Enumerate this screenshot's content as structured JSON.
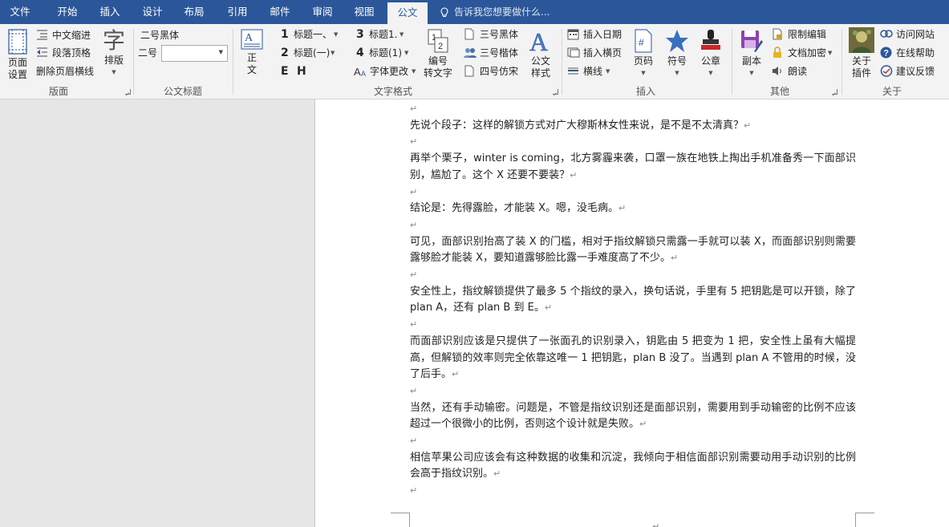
{
  "tabs": [
    "文件",
    "开始",
    "插入",
    "设计",
    "布局",
    "引用",
    "邮件",
    "审阅",
    "视图",
    "公文"
  ],
  "tell_me": "告诉我您想要做什么...",
  "ribbon": {
    "group_banmian": {
      "label": "版面",
      "page_setup": "页面\n设置",
      "cn_indent": "中文缩进",
      "para_top": "段落顶格",
      "del_header_line": "删除页眉横线",
      "layout": "排版"
    },
    "group_title": {
      "label": "公文标题",
      "font_label": "二号黑体",
      "size_label": "二号",
      "size_value": ""
    },
    "group_textformat": {
      "label": "文字格式",
      "zhengwen": "正\n文",
      "h1": "标题一、",
      "h2": "标题(一)",
      "h3": "标题1.",
      "h4": "标题(1)",
      "font_change": "字体更改",
      "num_prefix": [
        "1",
        "2",
        "3",
        "4"
      ],
      "bold_e": "E",
      "bold_h": "H",
      "seq_convert": "编号\n转文字",
      "f_heiti": "三号黑体",
      "f_kaiti": "三号楷体",
      "f_fangsong": "四号仿宋",
      "doc_style": "公文\n样式"
    },
    "group_insert": {
      "label": "插入",
      "insert_date": "插入日期",
      "insert_page": "插入横页",
      "hline": "横线",
      "page_num": "页码",
      "symbol": "符号",
      "seal": "公章"
    },
    "group_other": {
      "label": "其他",
      "copy": "副本",
      "restrict": "限制编辑",
      "encrypt": "文档加密",
      "read": "朗读"
    },
    "group_about": {
      "label": "关于",
      "about_plugin": "关于\n插件",
      "visit_site": "访问网站",
      "online_help": "在线帮助",
      "feedback": "建议反馈"
    }
  },
  "document": {
    "paragraphs": [
      {
        "text": "先说个段子：这样的解锁方式对广大穆斯林女性来说，是不是不太清真？"
      },
      {
        "text": "再举个栗子，winter is coming，北方雾霾来袭，口罩一族在地铁上掏出手机准备秀一下面部识别，尴尬了。这个 X 还要不要装？"
      },
      {
        "text": "结论是：先得露脸，才能装 X。嗯，没毛病。"
      },
      {
        "text": "可见，面部识别抬高了装 X 的门槛，相对于指纹解锁只需露一手就可以装 X，而面部识别则需要露够脸才能装 X，要知道露够脸比露一手难度高了不少。"
      },
      {
        "text": "安全性上，指纹解锁提供了最多 5 个指纹的录入，换句话说，手里有 5 把钥匙是可以开锁，除了 plan A，还有 plan B 到 E。"
      },
      {
        "text": "而面部识别应该是只提供了一张面孔的识别录入，钥匙由 5 把变为 1 把，安全性上虽有大幅提高，但解锁的效率则完全依靠这唯一 1 把钥匙，plan B 没了。当遇到 plan A 不管用的时候，没了后手。"
      },
      {
        "text": "当然，还有手动输密。问题是，不管是指纹识别还是面部识别，需要用到手动输密的比例不应该超过一个很微小的比例，否则这个设计就是失败。"
      },
      {
        "text": "相信苹果公司应该会有这种数据的收集和沉淀，我倾向于相信面部识别需要动用手动识别的比例会高于指纹识别。"
      }
    ],
    "mark": "↵"
  },
  "colors": {
    "accent": "#2b579a",
    "ribbon_bg": "#f3f3f3",
    "doc_bg": "#e6e6e6"
  }
}
